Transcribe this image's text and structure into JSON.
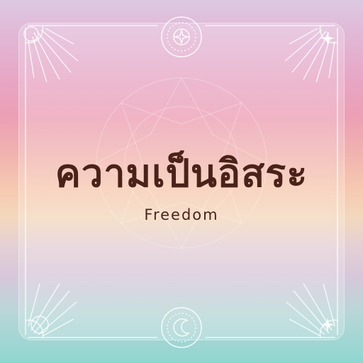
{
  "title": "ความเป็นอิสระ",
  "subtitle": "Freedom",
  "colors": {
    "text": "#4b2219",
    "frame": "#ffffff"
  },
  "icons": [
    "sun-medallion-icon",
    "moon-medallion-icon",
    "sparkle-star-icon",
    "lotus-mandala-icon"
  ]
}
